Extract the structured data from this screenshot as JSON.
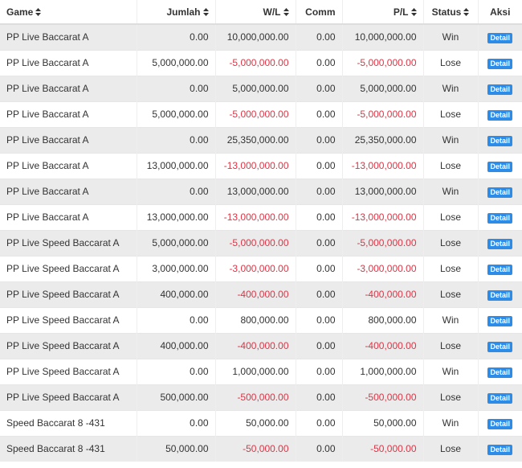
{
  "header": {
    "game": "Game",
    "jumlah": "Jumlah",
    "wl": "W/L",
    "comm": "Comm",
    "pl": "P/L",
    "status": "Status",
    "aksi": "Aksi"
  },
  "action_label": "Detail",
  "colors": {
    "negative": "#dc3545",
    "button": "#2d8ce8",
    "stripe": "#ebebeb"
  },
  "rows": [
    {
      "game": "PP Live Baccarat A",
      "jumlah": "0.00",
      "wl": "10,000,000.00",
      "comm": "0.00",
      "pl": "10,000,000.00",
      "status": "Win"
    },
    {
      "game": "PP Live Baccarat A",
      "jumlah": "5,000,000.00",
      "wl": "-5,000,000.00",
      "comm": "0.00",
      "pl": "-5,000,000.00",
      "status": "Lose"
    },
    {
      "game": "PP Live Baccarat A",
      "jumlah": "0.00",
      "wl": "5,000,000.00",
      "comm": "0.00",
      "pl": "5,000,000.00",
      "status": "Win"
    },
    {
      "game": "PP Live Baccarat A",
      "jumlah": "5,000,000.00",
      "wl": "-5,000,000.00",
      "comm": "0.00",
      "pl": "-5,000,000.00",
      "status": "Lose"
    },
    {
      "game": "PP Live Baccarat A",
      "jumlah": "0.00",
      "wl": "25,350,000.00",
      "comm": "0.00",
      "pl": "25,350,000.00",
      "status": "Win"
    },
    {
      "game": "PP Live Baccarat A",
      "jumlah": "13,000,000.00",
      "wl": "-13,000,000.00",
      "comm": "0.00",
      "pl": "-13,000,000.00",
      "status": "Lose"
    },
    {
      "game": "PP Live Baccarat A",
      "jumlah": "0.00",
      "wl": "13,000,000.00",
      "comm": "0.00",
      "pl": "13,000,000.00",
      "status": "Win"
    },
    {
      "game": "PP Live Baccarat A",
      "jumlah": "13,000,000.00",
      "wl": "-13,000,000.00",
      "comm": "0.00",
      "pl": "-13,000,000.00",
      "status": "Lose"
    },
    {
      "game": "PP Live Speed Baccarat A",
      "jumlah": "5,000,000.00",
      "wl": "-5,000,000.00",
      "comm": "0.00",
      "pl": "-5,000,000.00",
      "status": "Lose"
    },
    {
      "game": "PP Live Speed Baccarat A",
      "jumlah": "3,000,000.00",
      "wl": "-3,000,000.00",
      "comm": "0.00",
      "pl": "-3,000,000.00",
      "status": "Lose"
    },
    {
      "game": "PP Live Speed Baccarat A",
      "jumlah": "400,000.00",
      "wl": "-400,000.00",
      "comm": "0.00",
      "pl": "-400,000.00",
      "status": "Lose"
    },
    {
      "game": "PP Live Speed Baccarat A",
      "jumlah": "0.00",
      "wl": "800,000.00",
      "comm": "0.00",
      "pl": "800,000.00",
      "status": "Win"
    },
    {
      "game": "PP Live Speed Baccarat A",
      "jumlah": "400,000.00",
      "wl": "-400,000.00",
      "comm": "0.00",
      "pl": "-400,000.00",
      "status": "Lose"
    },
    {
      "game": "PP Live Speed Baccarat A",
      "jumlah": "0.00",
      "wl": "1,000,000.00",
      "comm": "0.00",
      "pl": "1,000,000.00",
      "status": "Win"
    },
    {
      "game": "PP Live Speed Baccarat A",
      "jumlah": "500,000.00",
      "wl": "-500,000.00",
      "comm": "0.00",
      "pl": "-500,000.00",
      "status": "Lose"
    },
    {
      "game": "Speed Baccarat 8 -431",
      "jumlah": "0.00",
      "wl": "50,000.00",
      "comm": "0.00",
      "pl": "50,000.00",
      "status": "Win"
    },
    {
      "game": "Speed Baccarat 8 -431",
      "jumlah": "50,000.00",
      "wl": "-50,000.00",
      "comm": "0.00",
      "pl": "-50,000.00",
      "status": "Lose"
    }
  ]
}
